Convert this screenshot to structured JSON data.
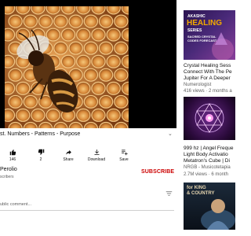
{
  "video": {
    "title": "st. Numbers - Patterns - Purpose",
    "more_chevron": "⌄"
  },
  "actions": [
    {
      "icon": "thumbs-up-icon",
      "label": "146"
    },
    {
      "icon": "thumbs-down-icon",
      "label": "2"
    },
    {
      "icon": "share-icon",
      "label": "Share"
    },
    {
      "icon": "download-icon",
      "label": "Download"
    },
    {
      "icon": "save-icon",
      "label": "Save"
    }
  ],
  "channel": {
    "name": "Perolio",
    "subs": "scribers",
    "subscribe_label": "SUBSCRIBE"
  },
  "comments": {
    "placeholder": "ublic comment..."
  },
  "sidebar": [
    {
      "thumb_lines": [
        "AKASHIC",
        "HEALING",
        "SERIES",
        "SACRED CRYSTAL",
        "CODES FORECAST"
      ],
      "title_lines": [
        "Crystal Healing Sess",
        "Connect With The Pe",
        "Jupiter For A Deeper"
      ],
      "channel": "Numerologist",
      "meta": "416 views · 2 months a"
    },
    {
      "thumb_lines": [],
      "title_lines": [
        "999 hz | Angel Freque",
        "Light Body Activatio",
        "Metatron's Cube | Di"
      ],
      "channel": "NRGB - Musicotetapia",
      "meta": "2.7M views · 6 month"
    },
    {
      "thumb_lines": [
        "for KING",
        "& COUNTRY"
      ],
      "title_lines": [],
      "channel": "",
      "meta": ""
    }
  ],
  "colors": {
    "subscribe": "#cc0000",
    "akashic_accent": "#f2a900",
    "player_bg": "#000000"
  }
}
